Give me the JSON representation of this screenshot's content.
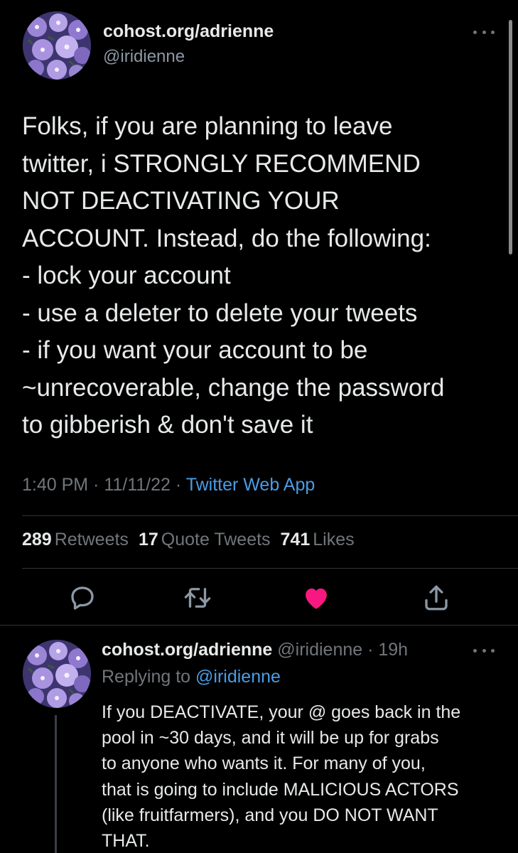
{
  "tweet": {
    "display_name": "cohost.org/adrienne",
    "handle": "@iridienne",
    "body": "Folks, if you are planning to leave\ntwitter, i STRONGLY RECOMMEND\nNOT DEACTIVATING YOUR\nACCOUNT. Instead, do the following:\n- lock your account\n- use a deleter to delete your tweets\n- if you want your account to be\n~unrecoverable, change the password\nto gibberish & don't save it",
    "time": "1:40 PM",
    "date": "11/11/22",
    "separator": " · ",
    "source": "Twitter Web App",
    "stats": {
      "retweets_count": "289",
      "retweets_label": "Retweets",
      "quotes_count": "17",
      "quotes_label": "Quote Tweets",
      "likes_count": "741",
      "likes_label": "Likes"
    },
    "liked": true
  },
  "reply": {
    "display_name": "cohost.org/adrienne",
    "handle": "@iridienne",
    "age": "19h",
    "replying_label": "Replying to",
    "replying_to": "@iridienne",
    "body": "If you DEACTIVATE, your @ goes back in the\npool in ~30 days, and it will be up for grabs\nto anyone who wants it. For many of you,\nthat is going to include MALICIOUS ACTORS\n(like fruitfarmers), and you DO NOT WANT\nTHAT."
  },
  "colors": {
    "background": "#000000",
    "text": "#e7e9ea",
    "secondary": "#71767b",
    "link": "#4a9ce6",
    "like": "#f91880"
  },
  "icons": [
    "more-icon",
    "reply-icon",
    "retweet-icon",
    "like-icon",
    "share-icon"
  ]
}
